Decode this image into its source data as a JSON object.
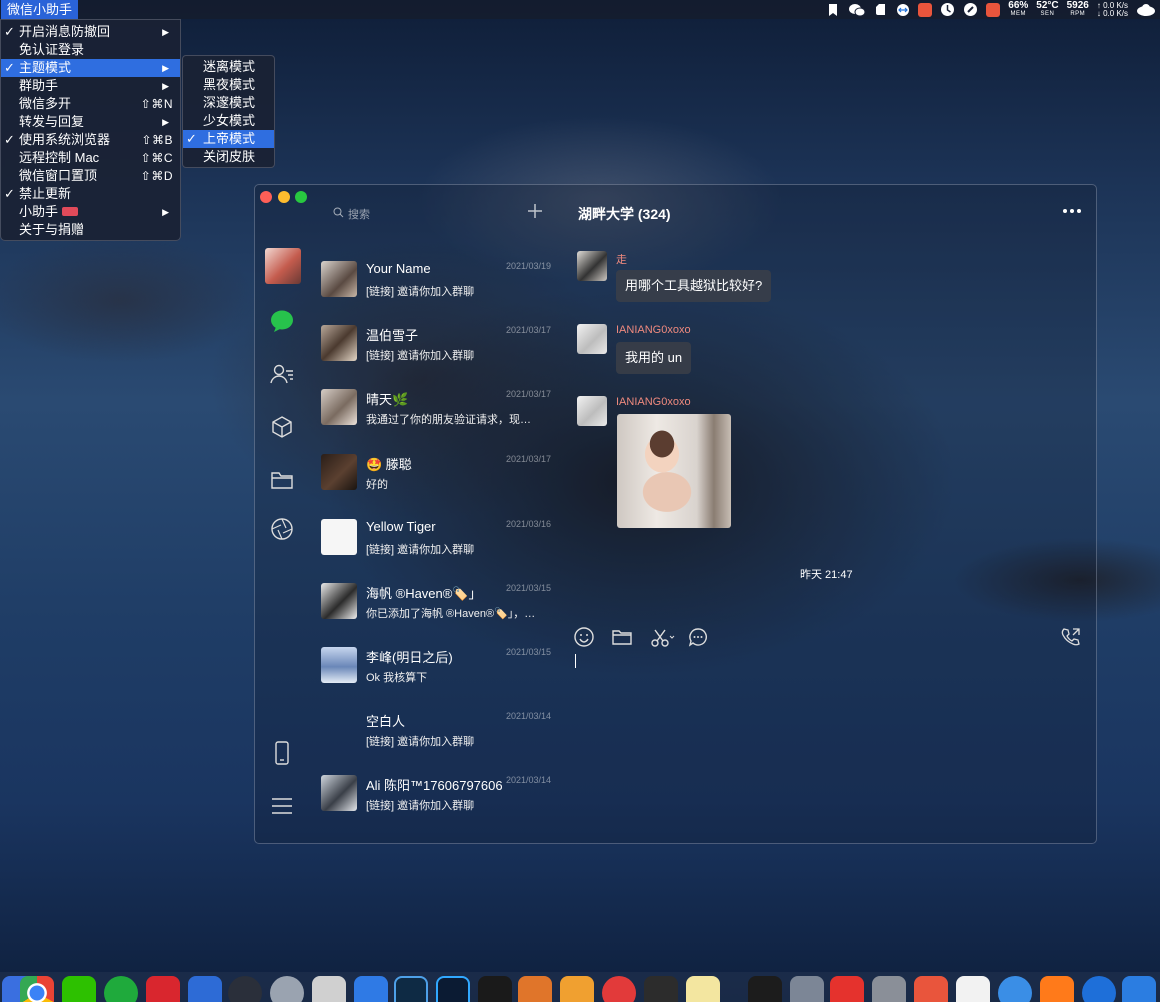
{
  "menubar": {
    "app_name": "微信小助手",
    "battery": "66%",
    "battery_label": "MEM",
    "temperature": "52°C",
    "temperature_label": "SEN",
    "fan": "5926",
    "fan_label": "RPM",
    "net_up": "↑ 0.0 K/s",
    "net_down": "↓ 0.0 K/s"
  },
  "dropdown": {
    "items": [
      {
        "label": "开启消息防撤回",
        "checked": true,
        "submenu": true,
        "shortcut": ""
      },
      {
        "label": "免认证登录",
        "checked": false,
        "submenu": false,
        "shortcut": ""
      },
      {
        "label": "主题模式",
        "checked": true,
        "submenu": true,
        "shortcut": "",
        "selected": true
      },
      {
        "label": "群助手",
        "checked": false,
        "submenu": true,
        "shortcut": ""
      },
      {
        "label": "微信多开",
        "checked": false,
        "submenu": false,
        "shortcut": "⇧⌘N"
      },
      {
        "label": "转发与回复",
        "checked": false,
        "submenu": true,
        "shortcut": ""
      },
      {
        "label": "使用系统浏览器",
        "checked": true,
        "submenu": false,
        "shortcut": "⇧⌘B"
      },
      {
        "label": "远程控制 Mac",
        "checked": false,
        "submenu": false,
        "shortcut": "⇧⌘C"
      },
      {
        "label": "微信窗口置顶",
        "checked": false,
        "submenu": false,
        "shortcut": "⇧⌘D"
      },
      {
        "label": "禁止更新",
        "checked": true,
        "submenu": false,
        "shortcut": ""
      },
      {
        "label": "小助手",
        "checked": false,
        "submenu": true,
        "shortcut": ""
      },
      {
        "label": "关于与捐赠",
        "checked": false,
        "submenu": false,
        "shortcut": ""
      }
    ],
    "check_glyph": "✓",
    "arrow_glyph": "▶"
  },
  "submenu": {
    "items": [
      {
        "label": "迷离模式",
        "checked": false
      },
      {
        "label": "黑夜模式",
        "checked": false
      },
      {
        "label": "深邃模式",
        "checked": false
      },
      {
        "label": "少女模式",
        "checked": false
      },
      {
        "label": "上帝模式",
        "checked": true,
        "selected": true
      },
      {
        "label": "关闭皮肤",
        "checked": false
      }
    ]
  },
  "wechat": {
    "search_placeholder": "搜索",
    "chat_title": "湖畔大学 (324)",
    "conversations": [
      {
        "name": "Your Name",
        "preview": "[链接] 邀请你加入群聊",
        "date": "2021/03/19"
      },
      {
        "name": "温伯雪子",
        "preview": "[链接] 邀请你加入群聊",
        "date": "2021/03/17"
      },
      {
        "name": "晴天🌿",
        "preview": "我通过了你的朋友验证请求，现…",
        "date": "2021/03/17"
      },
      {
        "name": "🤩 滕聪",
        "preview": "好的",
        "date": "2021/03/17"
      },
      {
        "name": "Yellow Tiger",
        "preview": "[链接] 邀请你加入群聊",
        "date": "2021/03/16"
      },
      {
        "name": "海帆 ®Haven®🏷️」",
        "preview": "你已添加了海帆 ®Haven®🏷️」，…",
        "date": "2021/03/15"
      },
      {
        "name": "李峰(明日之后)",
        "preview": "Ok 我核算下",
        "date": "2021/03/15"
      },
      {
        "name": "空白人",
        "preview": "[链接] 邀请你加入群聊",
        "date": "2021/03/14"
      },
      {
        "name": "Ali 陈阳™17606797606",
        "preview": "[链接] 邀请你加入群聊",
        "date": "2021/03/14"
      }
    ],
    "messages": [
      {
        "sender": "走",
        "text": "用哪个工具越狱比较好?"
      },
      {
        "sender": "IANIANG0xoxo",
        "text": "我用的 un"
      },
      {
        "sender": "IANIANG0xoxo",
        "text": ""
      }
    ],
    "timestamp": "昨天 21:47"
  },
  "colors": {
    "menu_highlight": "#2f6ee0",
    "sender_name": "#f08a7e",
    "bubble": "#3c4048"
  }
}
